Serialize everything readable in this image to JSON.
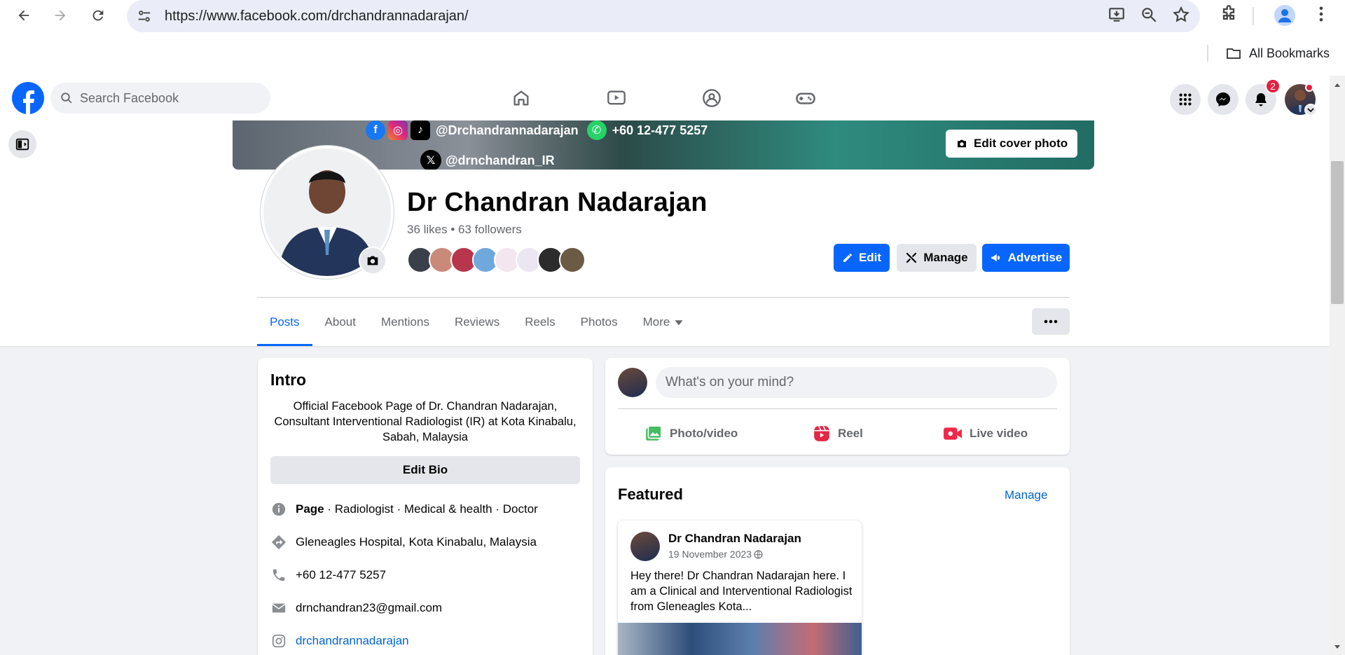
{
  "browser": {
    "url": "https://www.facebook.com/drchandrannadarajan/",
    "bookmarks_label": "All Bookmarks"
  },
  "fb_header": {
    "search_placeholder": "Search Facebook",
    "notifications_count": "2"
  },
  "cover": {
    "social_handle": "@Drchandrannadarajan",
    "phone": "+60 12-477 5257",
    "x_handle": "@drnchandran_IR",
    "edit_cover_label": "Edit cover photo"
  },
  "page": {
    "name": "Dr Chandran Nadarajan",
    "stats": "36 likes • 63 followers"
  },
  "actions": {
    "edit_label": "Edit",
    "manage_label": "Manage",
    "advertise_label": "Advertise"
  },
  "tabs": [
    {
      "label": "Posts"
    },
    {
      "label": "About"
    },
    {
      "label": "Mentions"
    },
    {
      "label": "Reviews"
    },
    {
      "label": "Reels"
    },
    {
      "label": "Photos"
    },
    {
      "label": "More"
    }
  ],
  "intro": {
    "title": "Intro",
    "bio": "Official Facebook Page of Dr. Chandran Nadarajan, Consultant Interventional Radiologist (IR) at Kota Kinabalu, Sabah, Malaysia",
    "edit_bio_label": "Edit Bio",
    "category_prefix": "Page",
    "category_rest": " · Radiologist · Medical & health · Doctor",
    "location": "Gleneagles Hospital, Kota Kinabalu, Malaysia",
    "phone": "+60 12-477 5257",
    "email": "drnchandran23@gmail.com",
    "instagram": "drchandrannadarajan"
  },
  "composer": {
    "placeholder": "What's on your mind?",
    "photo_label": "Photo/video",
    "reel_label": "Reel",
    "live_label": "Live video"
  },
  "featured": {
    "title": "Featured",
    "manage_label": "Manage",
    "post": {
      "author": "Dr Chandran Nadarajan",
      "date": "19 November 2023",
      "text": "Hey there! Dr Chandran Nadarajan here. I am a Clinical and Interventional Radiologist from Gleneagles Kota..."
    }
  },
  "colors": {
    "fb_blue": "#0866ff",
    "link_blue": "#0064d1",
    "badge_red": "#e41e3f"
  }
}
